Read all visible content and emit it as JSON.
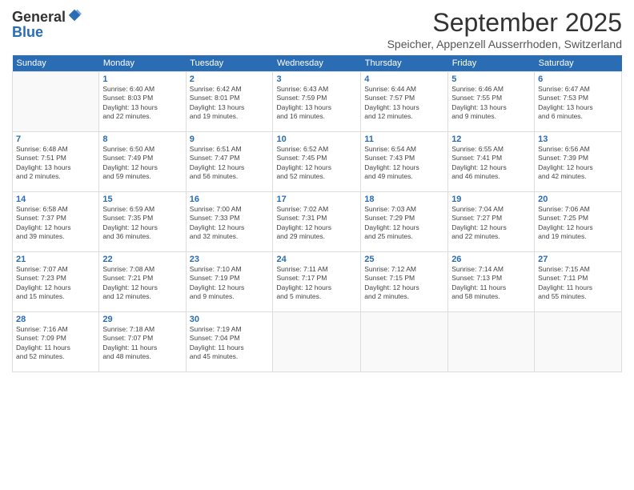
{
  "logo": {
    "general": "General",
    "blue": "Blue"
  },
  "title": "September 2025",
  "location": "Speicher, Appenzell Ausserrhoden, Switzerland",
  "days_of_week": [
    "Sunday",
    "Monday",
    "Tuesday",
    "Wednesday",
    "Thursday",
    "Friday",
    "Saturday"
  ],
  "weeks": [
    [
      {
        "day": "",
        "info": ""
      },
      {
        "day": "1",
        "info": "Sunrise: 6:40 AM\nSunset: 8:03 PM\nDaylight: 13 hours\nand 22 minutes."
      },
      {
        "day": "2",
        "info": "Sunrise: 6:42 AM\nSunset: 8:01 PM\nDaylight: 13 hours\nand 19 minutes."
      },
      {
        "day": "3",
        "info": "Sunrise: 6:43 AM\nSunset: 7:59 PM\nDaylight: 13 hours\nand 16 minutes."
      },
      {
        "day": "4",
        "info": "Sunrise: 6:44 AM\nSunset: 7:57 PM\nDaylight: 13 hours\nand 12 minutes."
      },
      {
        "day": "5",
        "info": "Sunrise: 6:46 AM\nSunset: 7:55 PM\nDaylight: 13 hours\nand 9 minutes."
      },
      {
        "day": "6",
        "info": "Sunrise: 6:47 AM\nSunset: 7:53 PM\nDaylight: 13 hours\nand 6 minutes."
      }
    ],
    [
      {
        "day": "7",
        "info": "Sunrise: 6:48 AM\nSunset: 7:51 PM\nDaylight: 13 hours\nand 2 minutes."
      },
      {
        "day": "8",
        "info": "Sunrise: 6:50 AM\nSunset: 7:49 PM\nDaylight: 12 hours\nand 59 minutes."
      },
      {
        "day": "9",
        "info": "Sunrise: 6:51 AM\nSunset: 7:47 PM\nDaylight: 12 hours\nand 56 minutes."
      },
      {
        "day": "10",
        "info": "Sunrise: 6:52 AM\nSunset: 7:45 PM\nDaylight: 12 hours\nand 52 minutes."
      },
      {
        "day": "11",
        "info": "Sunrise: 6:54 AM\nSunset: 7:43 PM\nDaylight: 12 hours\nand 49 minutes."
      },
      {
        "day": "12",
        "info": "Sunrise: 6:55 AM\nSunset: 7:41 PM\nDaylight: 12 hours\nand 46 minutes."
      },
      {
        "day": "13",
        "info": "Sunrise: 6:56 AM\nSunset: 7:39 PM\nDaylight: 12 hours\nand 42 minutes."
      }
    ],
    [
      {
        "day": "14",
        "info": "Sunrise: 6:58 AM\nSunset: 7:37 PM\nDaylight: 12 hours\nand 39 minutes."
      },
      {
        "day": "15",
        "info": "Sunrise: 6:59 AM\nSunset: 7:35 PM\nDaylight: 12 hours\nand 36 minutes."
      },
      {
        "day": "16",
        "info": "Sunrise: 7:00 AM\nSunset: 7:33 PM\nDaylight: 12 hours\nand 32 minutes."
      },
      {
        "day": "17",
        "info": "Sunrise: 7:02 AM\nSunset: 7:31 PM\nDaylight: 12 hours\nand 29 minutes."
      },
      {
        "day": "18",
        "info": "Sunrise: 7:03 AM\nSunset: 7:29 PM\nDaylight: 12 hours\nand 25 minutes."
      },
      {
        "day": "19",
        "info": "Sunrise: 7:04 AM\nSunset: 7:27 PM\nDaylight: 12 hours\nand 22 minutes."
      },
      {
        "day": "20",
        "info": "Sunrise: 7:06 AM\nSunset: 7:25 PM\nDaylight: 12 hours\nand 19 minutes."
      }
    ],
    [
      {
        "day": "21",
        "info": "Sunrise: 7:07 AM\nSunset: 7:23 PM\nDaylight: 12 hours\nand 15 minutes."
      },
      {
        "day": "22",
        "info": "Sunrise: 7:08 AM\nSunset: 7:21 PM\nDaylight: 12 hours\nand 12 minutes."
      },
      {
        "day": "23",
        "info": "Sunrise: 7:10 AM\nSunset: 7:19 PM\nDaylight: 12 hours\nand 9 minutes."
      },
      {
        "day": "24",
        "info": "Sunrise: 7:11 AM\nSunset: 7:17 PM\nDaylight: 12 hours\nand 5 minutes."
      },
      {
        "day": "25",
        "info": "Sunrise: 7:12 AM\nSunset: 7:15 PM\nDaylight: 12 hours\nand 2 minutes."
      },
      {
        "day": "26",
        "info": "Sunrise: 7:14 AM\nSunset: 7:13 PM\nDaylight: 11 hours\nand 58 minutes."
      },
      {
        "day": "27",
        "info": "Sunrise: 7:15 AM\nSunset: 7:11 PM\nDaylight: 11 hours\nand 55 minutes."
      }
    ],
    [
      {
        "day": "28",
        "info": "Sunrise: 7:16 AM\nSunset: 7:09 PM\nDaylight: 11 hours\nand 52 minutes."
      },
      {
        "day": "29",
        "info": "Sunrise: 7:18 AM\nSunset: 7:07 PM\nDaylight: 11 hours\nand 48 minutes."
      },
      {
        "day": "30",
        "info": "Sunrise: 7:19 AM\nSunset: 7:04 PM\nDaylight: 11 hours\nand 45 minutes."
      },
      {
        "day": "",
        "info": ""
      },
      {
        "day": "",
        "info": ""
      },
      {
        "day": "",
        "info": ""
      },
      {
        "day": "",
        "info": ""
      }
    ]
  ]
}
